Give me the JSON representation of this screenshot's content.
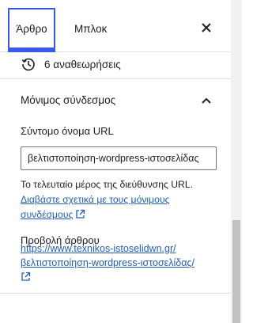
{
  "tabs": [
    {
      "label": "Άρθρο",
      "active": true
    },
    {
      "label": "Μπλοκ",
      "active": false
    }
  ],
  "close_icon": "close-icon",
  "revisions": {
    "icon": "history-icon",
    "label": "6 αναθεωρήσεις"
  },
  "permalink_panel": {
    "title": "Μόνιμος σύνδεσμος",
    "expanded": true,
    "slug_label": "Σύντομο όνομα URL",
    "slug_value": "βελτιστοποίηση-wordpress-ιστοσελίδας",
    "help_text": "Το τελευταίο μέρος της διεύθυνσης URL.",
    "help_link_line1": "Διαβάστε σχετικά με τους μόνιμους",
    "help_link_line2": "συνδέσμους",
    "view_label": "Προβολή άρθρου",
    "view_link_line1": "https://www.texnikos-istoselidwn.gr/",
    "view_link_line2": "βελτιστοποίηση-wordpress-ιστοσελίδας/"
  },
  "colors": {
    "accent": "#3858e9",
    "link": "#1f5fb3",
    "text": "#1e1e1e",
    "border": "#e0e0e0"
  }
}
